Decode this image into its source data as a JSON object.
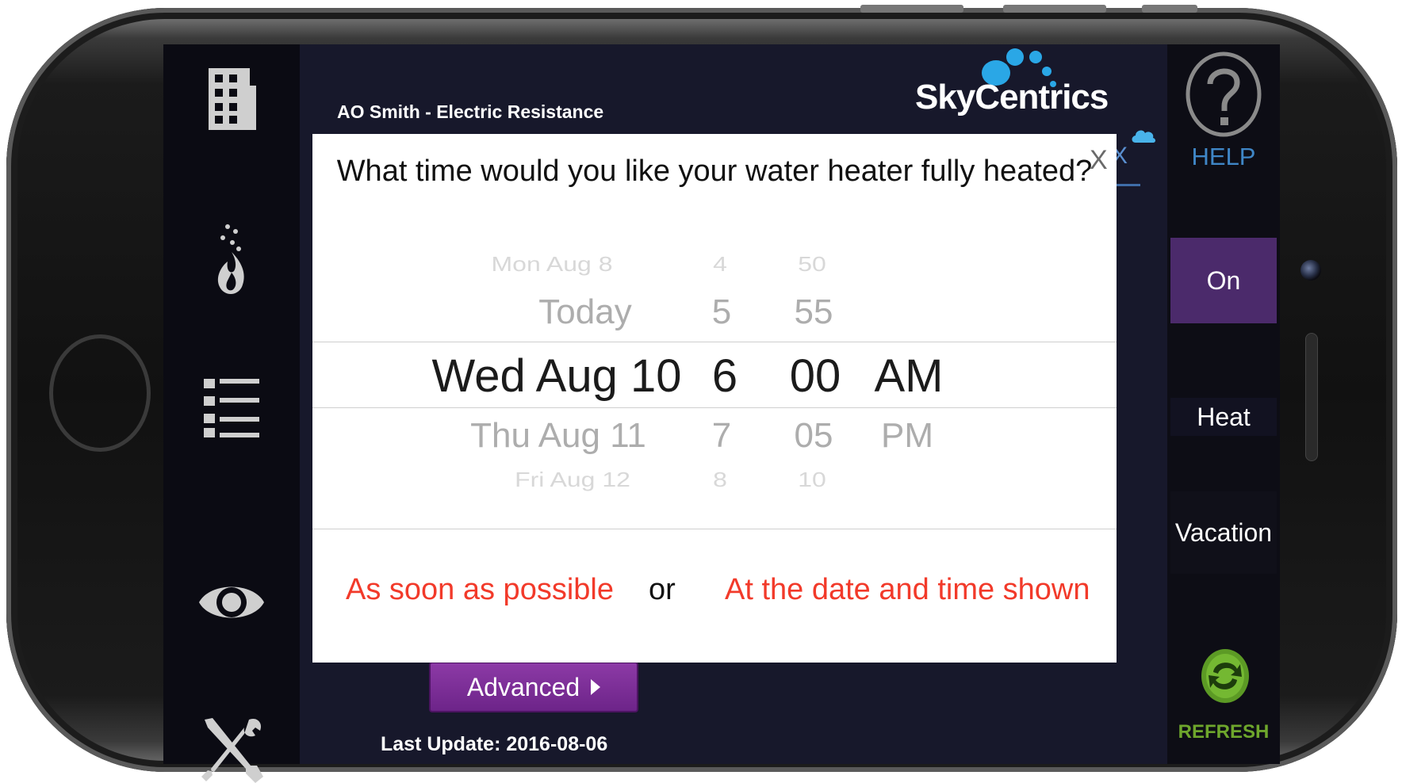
{
  "app": {
    "device_title": "AO Smith - Electric Resistance",
    "brand": "SkyCentrics",
    "last_update": "Last Update: 2016-08-06",
    "advanced_label": "Advanced"
  },
  "left_nav": {
    "items": [
      {
        "icon": "building-icon"
      },
      {
        "icon": "flame-icon"
      },
      {
        "icon": "list-icon"
      },
      {
        "icon": "eye-icon"
      },
      {
        "icon": "tools-icon"
      }
    ]
  },
  "right_bar": {
    "help_label": "HELP",
    "modes": [
      "On",
      "Heat",
      "Vacation"
    ],
    "refresh_label": "REFRESH",
    "partial_label": "X"
  },
  "modal": {
    "question": "What time would you like your water heater fully heated?",
    "close_label": "X",
    "picker": {
      "days": [
        "Mon Aug 8",
        "Today",
        "Wed Aug 10",
        "Thu Aug 11",
        "Fri Aug 12"
      ],
      "hours": [
        "4",
        "5",
        "6",
        "7",
        "8"
      ],
      "minutes": [
        "50",
        "55",
        "00",
        "05",
        "10"
      ],
      "ampm": [
        "AM",
        "PM"
      ],
      "selected": {
        "day": "Wed Aug 10",
        "hour": "6",
        "minute": "00",
        "ampm": "AM"
      }
    },
    "option_asap": "As soon as possible",
    "option_or": "or",
    "option_shown": "At the date and time shown"
  },
  "colors": {
    "accent_red": "#f23a2a",
    "purple": "#6d2489",
    "help_blue": "#3f86c6",
    "refresh_green": "#6ea62c"
  }
}
